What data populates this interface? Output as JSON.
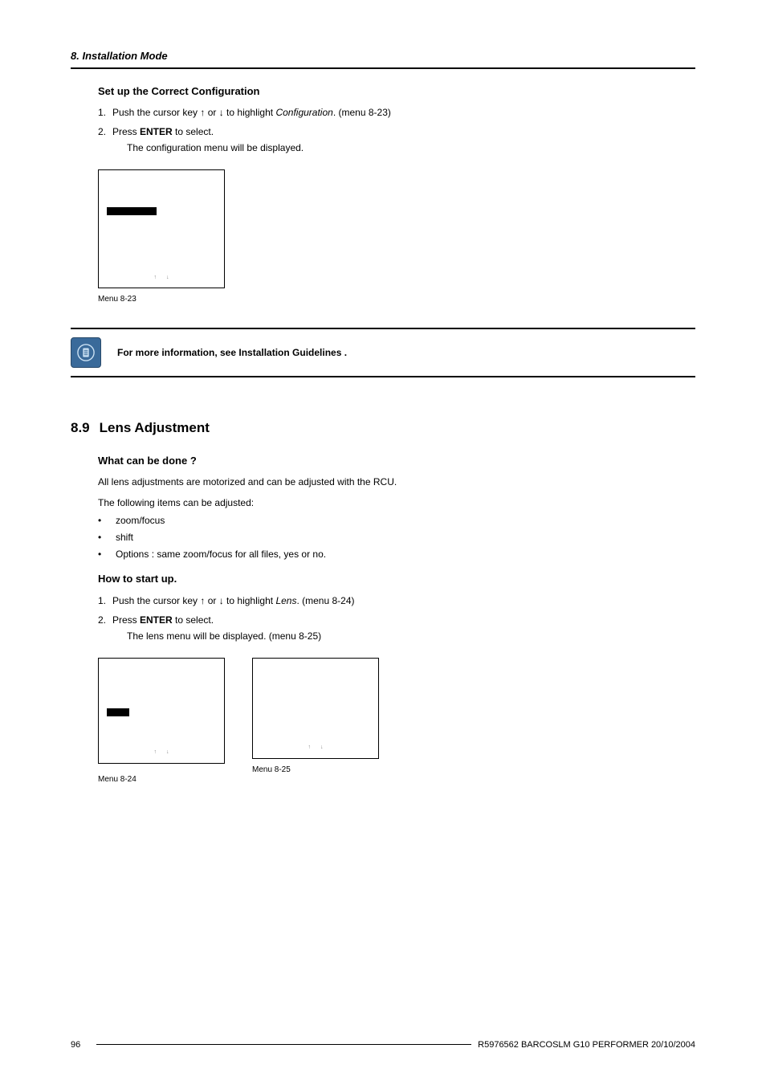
{
  "header": {
    "chapter": "8. Installation Mode"
  },
  "sec_config": {
    "title": "Set up the Correct Configuration",
    "step1_pre": "Push the cursor key ↑ or ↓ to highlight ",
    "step1_ital": "Configuration",
    "step1_post": ". (menu 8-23)",
    "step2_pre": "Press ",
    "step2_bold": "ENTER",
    "step2_post": " to select.",
    "step2_note": "The configuration menu will be displayed.",
    "menu_caption": "Menu 8-23",
    "menu_footer": {
      "up": "↑",
      "down": "↓"
    }
  },
  "info_note": "For more information, see Installation Guidelines .",
  "sec_lens": {
    "num": "8.9",
    "title": "Lens Adjustment",
    "what_title": "What can be done ?",
    "what_p1": "All lens adjustments are motorized and can be adjusted with the RCU.",
    "what_p2": "The following items can be adjusted:",
    "bullets": {
      "b1": "zoom/focus",
      "b2": "shift",
      "b3": "Options : same zoom/focus for all files, yes or no."
    },
    "how_title": "How to start up.",
    "how1_pre": "Push the cursor key ↑ or ↓ to highlight ",
    "how1_ital": "Lens",
    "how1_post": ". (menu 8-24)",
    "how2_pre": "Press ",
    "how2_bold": "ENTER",
    "how2_post": " to select.",
    "how2_note": "The lens menu will be displayed. (menu 8-25)",
    "menu24_caption": "Menu 8-24",
    "menu25_caption": "Menu 8-25",
    "menu_footer": {
      "up": "↑",
      "down": "↓"
    }
  },
  "footer": {
    "page": "96",
    "doc": "R5976562  BARCOSLM G10 PERFORMER  20/10/2004"
  }
}
